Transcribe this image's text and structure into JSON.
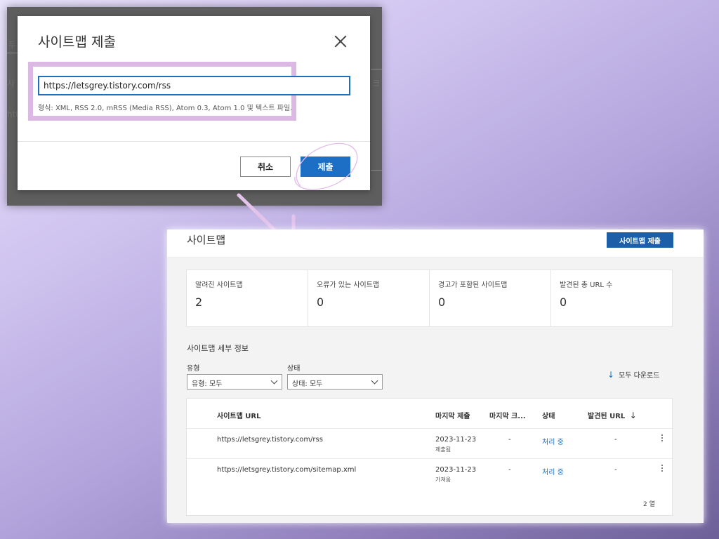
{
  "background_fragments": [
    "두",
    "사",
    "크",
    "htt"
  ],
  "dialog": {
    "title": "사이트맵 제출",
    "close_icon": "close-icon",
    "input_value": "https://letsgrey.tistory.com/rss",
    "hint": "형식: XML, RSS 2.0, mRSS (Media RSS), Atom 0.3, Atom 1.0 및 텍스트 파일.",
    "cancel_label": "취소",
    "submit_label": "제출"
  },
  "page": {
    "title": "사이트맵",
    "submit_button": "사이트맵 제출",
    "stats": [
      {
        "label": "알려진 사이트맵",
        "value": "2"
      },
      {
        "label": "오류가 있는 사이트맵",
        "value": "0"
      },
      {
        "label": "경고가 포함된 사이트맵",
        "value": "0"
      },
      {
        "label": "발견된 총 URL 수",
        "value": "0"
      }
    ],
    "details_title": "사이트맵 세부 정보",
    "filters": {
      "type_label": "유형",
      "type_value": "유형: 모두",
      "status_label": "상태",
      "status_value": "상태: 모두"
    },
    "download_label": "모두 다운로드",
    "download_icon": "download-icon",
    "table": {
      "columns": [
        "사이트맵 URL",
        "마지막 제출",
        "마지막 크...",
        "상태",
        "발견된 URL"
      ],
      "sort_icon": "↓",
      "rows": [
        {
          "url": "https://letsgrey.tistory.com/rss",
          "date": "2023-11-23",
          "date_sub": "제출됨",
          "last_crawl": "-",
          "status": "처리 중",
          "found": "-"
        },
        {
          "url": "https://letsgrey.tistory.com/sitemap.xml",
          "date": "2023-11-23",
          "date_sub": "가져옴",
          "last_crawl": "-",
          "status": "처리 중",
          "found": "-"
        }
      ],
      "row_count": "2 열"
    }
  }
}
